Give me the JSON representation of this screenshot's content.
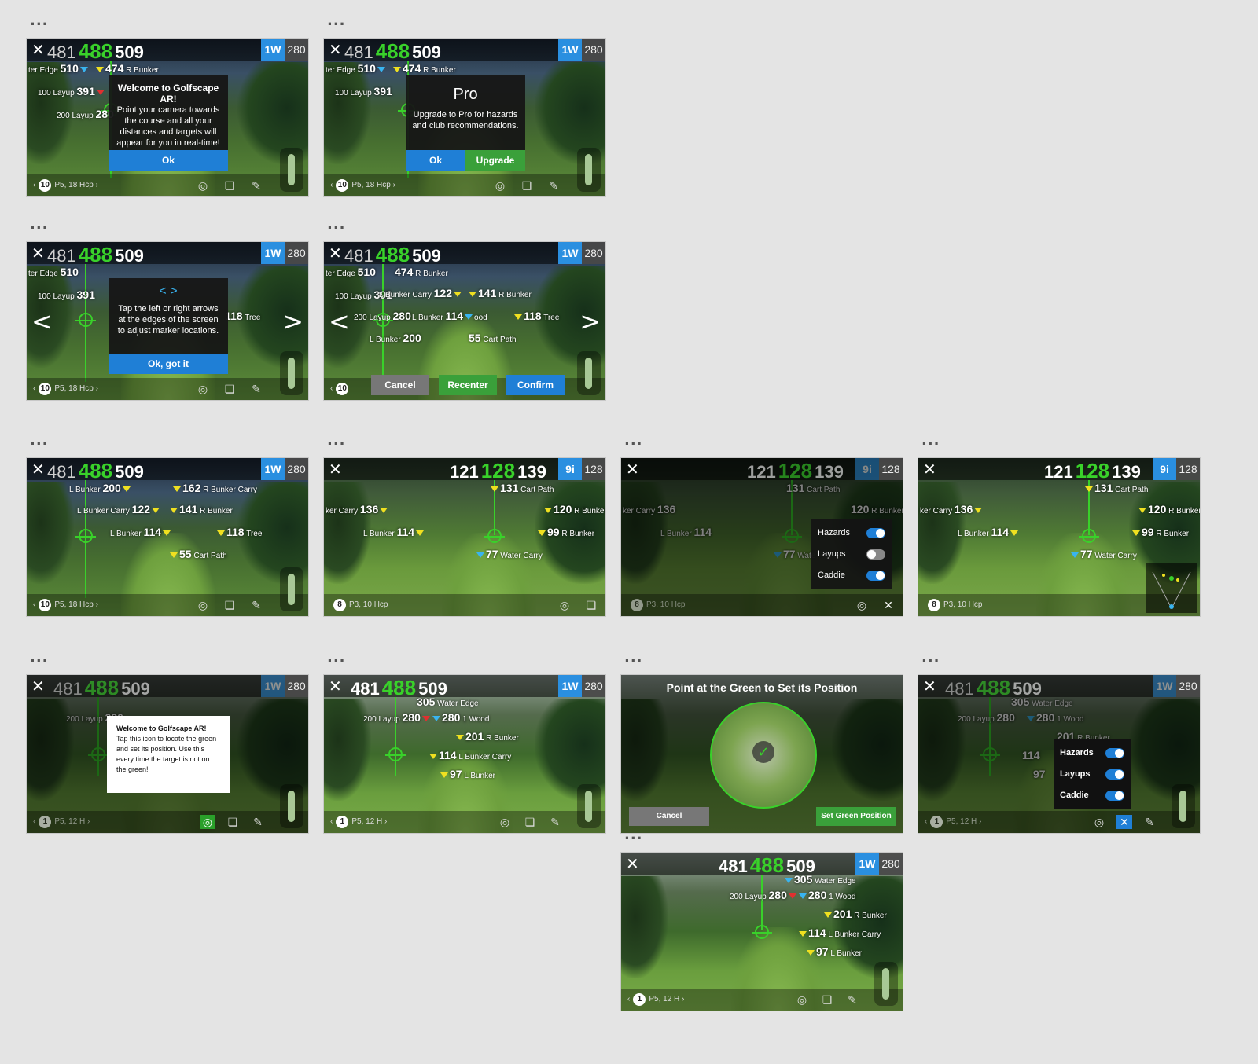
{
  "ui": {
    "dots": "...",
    "x": "✕",
    "prev": "‹",
    "next": "›",
    "left_arrow": "<",
    "right_arrow": ">",
    "arrows_glyph": "< >",
    "check": "✓",
    "target_glyph": "◎",
    "layers_glyph": "❏",
    "pencil_glyph": "✎",
    "close_glyph": "✕"
  },
  "hud_a": {
    "d1": "481",
    "d2": "488",
    "d3": "509",
    "club": "1W",
    "club_dist": "280",
    "hole_num": "10",
    "hole_info": "P5, 18 Hcp"
  },
  "hud_b": {
    "d1": "121",
    "d2": "128",
    "d3": "139",
    "club": "9i",
    "club_dist": "128",
    "hole_num": "8",
    "hole_info": "P3, 10 Hcp"
  },
  "hud_c": {
    "d1": "481",
    "d2": "488",
    "d3": "509",
    "club": "1W",
    "club_dist": "280",
    "hole_num": "1",
    "hole_info": "P5, 12 H"
  },
  "tags_a": {
    "water_edge": "510",
    "water_edge_label": "ter Edge",
    "bunker474": "474",
    "bunker474_label": "R Bunker",
    "layup100": "391",
    "layup100_label": "100 Layup",
    "layup200": "280",
    "layup200_label": "200 Layup",
    "lbunker": "200",
    "lbunker_label": "L Bunker",
    "carry162": "162",
    "carry162_label": "R Bunker Carry",
    "carry122": "122",
    "carry122_label": "L Bunker Carry",
    "rb141": "141",
    "rb141_label": "R Bunker",
    "lb114": "114",
    "lb114_label": "L Bunker",
    "tree118": "118",
    "tree118_label": "Tree",
    "cart55": "55",
    "cart55_label": "Cart Path",
    "wood_label": "ood"
  },
  "tags_b": {
    "cp131": "131",
    "cp131_label": "Cart Path",
    "carry136": "136",
    "carry136_label": "ker Carry",
    "rb120": "120",
    "rb120_label": "R Bunker",
    "lb114": "114",
    "lb114_label": "L Bunker",
    "rb99": "99",
    "rb99_label": "R Bunker",
    "wc77": "77",
    "wc77_label": "Water Carry",
    "wc77_short": "Wate"
  },
  "tags_c": {
    "we305": "305",
    "we305_label": "Water Edge",
    "layup280": "280",
    "layup280_label": "200 Layup",
    "wood280": "280",
    "wood280_label": "1 Wood",
    "rb201": "201",
    "rb201_label": "R Bunker",
    "lbc114": "114",
    "lbc114_label": "L Bunker Carry",
    "lb97": "97",
    "lb97_label": "L Bunker"
  },
  "dlg_welcome": {
    "title": "Welcome to Golfscape AR!",
    "body": "Point your camera towards the course and all your distances and targets will appear for you in real-time!",
    "ok": "Ok"
  },
  "dlg_pro": {
    "title": "Pro",
    "body": "Upgrade to Pro for hazards and club recommendations.",
    "ok": "Ok",
    "upgrade": "Upgrade"
  },
  "dlg_arrows": {
    "body": "Tap the left or right arrows at the edges of the screen to adjust marker locations.",
    "ok": "Ok, got it"
  },
  "adjust": {
    "cancel": "Cancel",
    "recenter": "Recenter",
    "confirm": "Confirm"
  },
  "toggles": {
    "hazards": "Hazards",
    "layups": "Layups",
    "caddie": "Caddie"
  },
  "dlg_green": {
    "title": "Welcome to Golfscape AR!",
    "body": "Tap this icon to locate the green and set its position. Use this every time the target is not on the green!"
  },
  "green": {
    "title": "Point at the Green to Set its Position",
    "cancel": "Cancel",
    "set": "Set Green Position"
  }
}
